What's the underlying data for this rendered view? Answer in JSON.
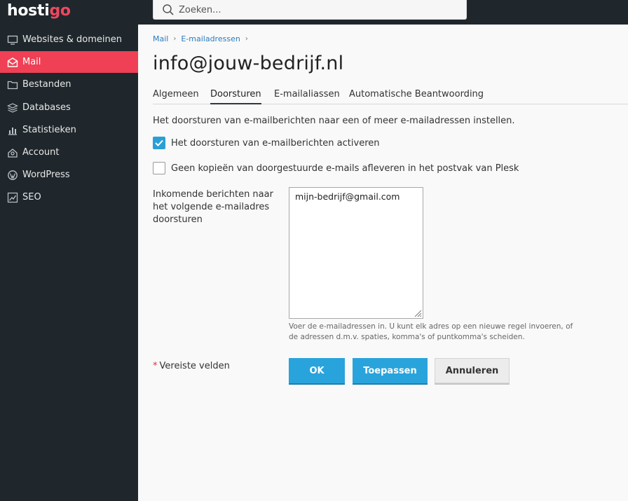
{
  "brand": {
    "logo_main": "hosti",
    "logo_accent": "go"
  },
  "search": {
    "placeholder": "Zoeken..."
  },
  "sidebar": {
    "items": [
      {
        "label": "Websites & domeinen",
        "icon": "monitor-icon",
        "active": false
      },
      {
        "label": "Mail",
        "icon": "envelope-icon",
        "active": true
      },
      {
        "label": "Bestanden",
        "icon": "folder-icon",
        "active": false
      },
      {
        "label": "Databases",
        "icon": "layers-icon",
        "active": false
      },
      {
        "label": "Statistieken",
        "icon": "bar-chart-icon",
        "active": false
      },
      {
        "label": "Account",
        "icon": "account-icon",
        "active": false
      },
      {
        "label": "WordPress",
        "icon": "wordpress-icon",
        "active": false
      },
      {
        "label": "SEO",
        "icon": "seo-chart-icon",
        "active": false
      }
    ]
  },
  "breadcrumb": {
    "items": [
      "Mail",
      "E-mailadressen"
    ]
  },
  "page": {
    "title": "info@jouw-bedrijf.nl"
  },
  "tabs": [
    {
      "label": "Algemeen",
      "active": false
    },
    {
      "label": "Doorsturen",
      "active": true
    },
    {
      "label": "E-mailaliassen",
      "active": false
    },
    {
      "label": "Automatische Beantwoording",
      "active": false
    }
  ],
  "form": {
    "description": "Het doorsturen van e-mailberichten naar een of meer e-mailadressen instellen.",
    "checkbox_activate": {
      "label": "Het doorsturen van e-mailberichten activeren",
      "checked": true
    },
    "checkbox_nocopy": {
      "label": "Geen kopieën van doorgestuurde e-mails afleveren in het postvak van Plesk",
      "checked": false
    },
    "forward_label": "Inkomende berichten naar het volgende e-mailadres doorsturen",
    "forward_value": "mijn-bedrijf@gmail.com",
    "hint": "Voer de e-mailadressen in. U kunt elk adres op een nieuwe regel invoeren, of de adressen d.m.v. spaties, komma's of puntkomma's scheiden.",
    "required_note": "Vereiste velden",
    "required_star": "*"
  },
  "buttons": {
    "ok": "OK",
    "apply": "Toepassen",
    "cancel": "Annuleren"
  },
  "colors": {
    "accent": "#ef4055",
    "primary_button": "#29a3dc",
    "sidebar_bg": "#1f272c",
    "link": "#2b7bbf"
  }
}
